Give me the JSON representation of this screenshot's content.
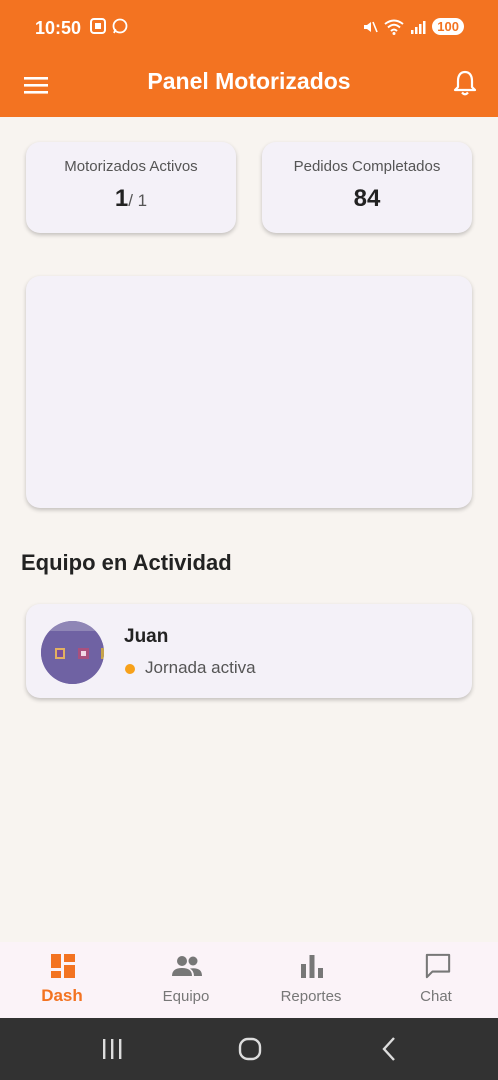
{
  "status_bar": {
    "time": "10:50",
    "battery": "100"
  },
  "app_bar": {
    "title": "Panel Motorizados"
  },
  "stats": {
    "active_riders": {
      "label": "Motorizados Activos",
      "value": "1",
      "total": "/ 1"
    },
    "completed_orders": {
      "label": "Pedidos Completados",
      "value": "84"
    }
  },
  "team_section": {
    "title": "Equipo en Actividad",
    "members": [
      {
        "name": "Juan",
        "status": "Jornada activa",
        "status_color": "#f7a11a"
      }
    ]
  },
  "bottom_nav": {
    "items": [
      {
        "label": "Dash",
        "icon": "dashboard-icon",
        "active": true
      },
      {
        "label": "Equipo",
        "icon": "people-icon",
        "active": false
      },
      {
        "label": "Reportes",
        "icon": "bar-chart-icon",
        "active": false
      },
      {
        "label": "Chat",
        "icon": "chat-bubble-icon",
        "active": false
      }
    ]
  },
  "colors": {
    "primary": "#f37321",
    "background": "#f8f4f0",
    "card": "#f4f1f8"
  }
}
